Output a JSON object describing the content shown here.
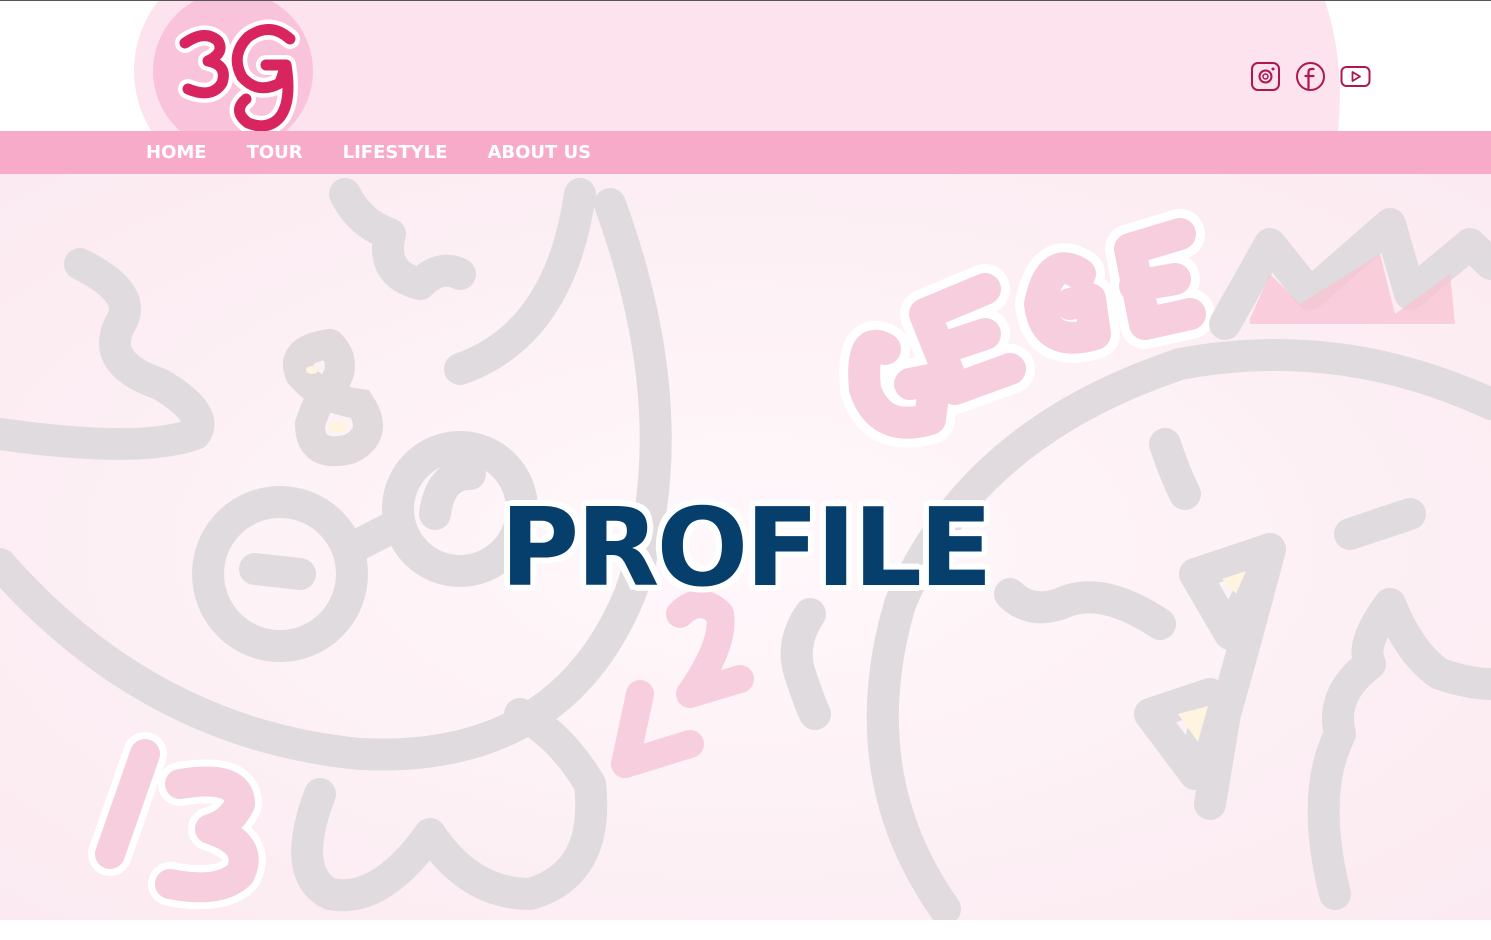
{
  "brand": {
    "logo_text": "3G",
    "logo_color": "#d8245f",
    "logo_bg": "#f9c3dc"
  },
  "header": {
    "social": [
      {
        "name": "instagram-icon"
      },
      {
        "name": "facebook-icon"
      },
      {
        "name": "youtube-icon"
      }
    ]
  },
  "nav": {
    "items": [
      {
        "label": "HOME"
      },
      {
        "label": "TOUR"
      },
      {
        "label": "LIFESTYLE"
      },
      {
        "label": "ABOUT US"
      }
    ],
    "bg_color": "#f7abc9",
    "text_color": "#ffffff"
  },
  "hero": {
    "title": "PROFILE",
    "title_color": "#063e6c",
    "background_text": [
      "GEGE",
      "13",
      "8",
      "25"
    ]
  }
}
